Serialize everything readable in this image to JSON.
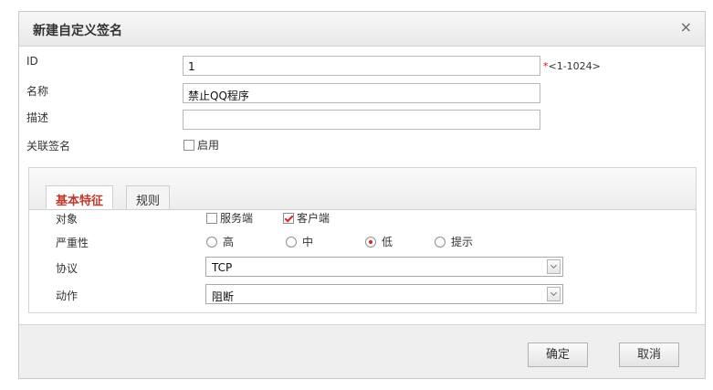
{
  "dialog": {
    "title": "新建自定义签名",
    "close_glyph": "×"
  },
  "form": {
    "id_label": "ID",
    "id_value": "1",
    "id_hint_star": "*",
    "id_hint_range": "<1-1024>",
    "name_label": "名称",
    "name_value": "禁止QQ程序",
    "desc_label": "描述",
    "desc_value": "",
    "related_label": "关联签名",
    "related_enable_label": "启用",
    "related_enabled": false
  },
  "tabs": [
    {
      "label": "基本特征",
      "active": true
    },
    {
      "label": "规则",
      "active": false
    }
  ],
  "basic": {
    "object_label": "对象",
    "object_options": [
      {
        "label": "服务端",
        "checked": false
      },
      {
        "label": "客户端",
        "checked": true
      }
    ],
    "severity_label": "严重性",
    "severity_options": [
      {
        "label": "高",
        "selected": false
      },
      {
        "label": "中",
        "selected": false
      },
      {
        "label": "低",
        "selected": true
      },
      {
        "label": "提示",
        "selected": false
      }
    ],
    "protocol_label": "协议",
    "protocol_value": "TCP",
    "action_label": "动作",
    "action_value": "阻断"
  },
  "footer": {
    "ok_label": "确定",
    "cancel_label": "取消"
  },
  "colors": {
    "accent_red": "#d22222",
    "active_tab_text": "#c0392b"
  }
}
